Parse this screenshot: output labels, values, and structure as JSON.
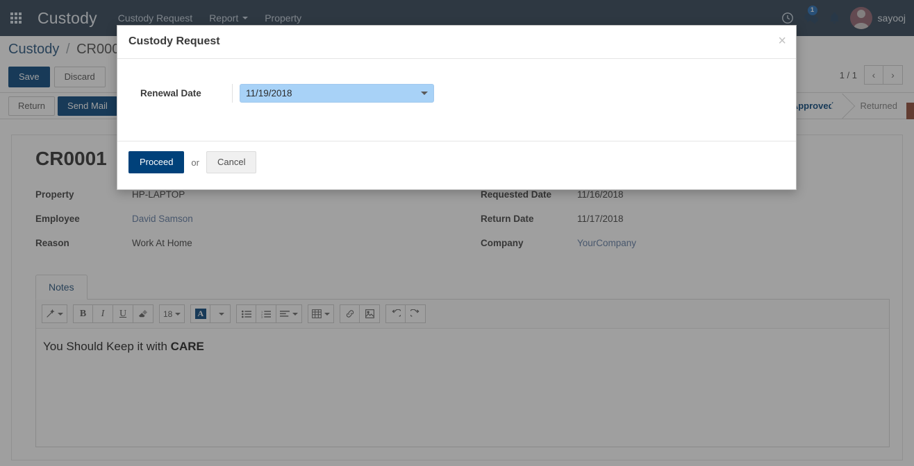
{
  "navbar": {
    "apps_icon": "apps-grid-icon",
    "brand": "Custody",
    "menu": [
      {
        "label": "Custody Request",
        "has_caret": false
      },
      {
        "label": "Report",
        "has_caret": true
      },
      {
        "label": "Property",
        "has_caret": false
      }
    ],
    "icons": {
      "activity": "clock-icon",
      "messages": "chat-bubbles-icon",
      "notifications": "bell-icon"
    },
    "messages_badge": "1",
    "user_name": "sayooj"
  },
  "control_panel": {
    "breadcrumb_root": "Custody",
    "breadcrumb_separator": "/",
    "breadcrumb_current": "CR0001",
    "save_label": "Save",
    "discard_label": "Discard",
    "pager_text": "1 / 1",
    "prev_icon": "chevron-left-icon",
    "next_icon": "chevron-right-icon"
  },
  "action_bar": {
    "buttons": [
      {
        "label": "Return",
        "active": false
      },
      {
        "label": "Send Mail",
        "active": true
      }
    ],
    "status_steps": [
      {
        "label": "Approved",
        "state": "done"
      },
      {
        "label": "Returned",
        "state": "pending"
      }
    ]
  },
  "record": {
    "title": "CR0001",
    "left_fields": [
      {
        "label": "Property",
        "value": "HP-LAPTOP",
        "is_link": false
      },
      {
        "label": "Employee",
        "value": "David Samson",
        "is_link": true
      },
      {
        "label": "Reason",
        "value": "Work At Home",
        "is_link": false
      }
    ],
    "right_fields": [
      {
        "label": "Requested Date",
        "value": "11/16/2018",
        "is_link": false
      },
      {
        "label": "Return Date",
        "value": "11/17/2018",
        "is_link": false
      },
      {
        "label": "Company",
        "value": "YourCompany",
        "is_link": true
      }
    ]
  },
  "notebook": {
    "tabs": [
      {
        "label": "Notes",
        "active": true
      }
    ],
    "toolbar": {
      "style_icon": "magic-wand-icon",
      "bold_label": "B",
      "italic_label": "I",
      "underline_label": "U",
      "eraser_icon": "eraser-icon",
      "font_size": "18",
      "font_color_label": "A",
      "ul_icon": "unordered-list-icon",
      "ol_icon": "ordered-list-icon",
      "align_icon": "align-left-icon",
      "table_icon": "table-icon",
      "link_icon": "link-icon",
      "image_icon": "image-icon",
      "undo_icon": "undo-icon",
      "redo_icon": "redo-icon"
    },
    "note_text_plain": "You Should Keep it with ",
    "note_text_bold": "CARE"
  },
  "modal": {
    "title": "Custody Request",
    "close_icon": "close-icon",
    "field_label": "Renewal Date",
    "date_value": "11/19/2018",
    "date_caret_icon": "chevron-down-icon",
    "proceed_label": "Proceed",
    "or_label": "or",
    "cancel_label": "Cancel"
  },
  "colors": {
    "navbar_bg": "#2b3e50",
    "primary": "#00417a",
    "link": "#5b77a0",
    "date_field_bg": "#a8d2f7",
    "scroll_strip": "#8c4530"
  }
}
